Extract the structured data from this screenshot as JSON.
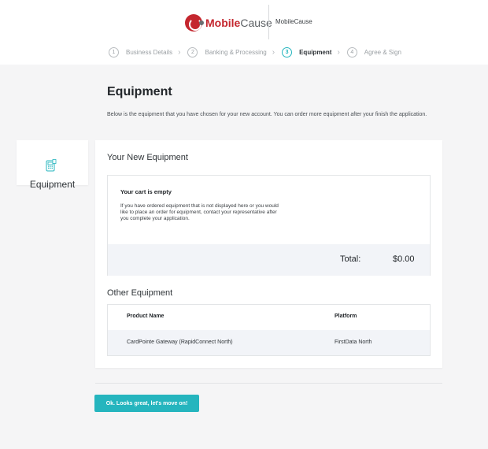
{
  "header": {
    "logo_strong": "Mobile",
    "logo_light": "Cause",
    "brand_name": "MobileCause"
  },
  "steps": [
    {
      "num": "1",
      "label": "Business Details",
      "active": false
    },
    {
      "num": "2",
      "label": "Banking & Processing",
      "active": false
    },
    {
      "num": "3",
      "label": "Equipment",
      "active": true
    },
    {
      "num": "4",
      "label": "Agree & Sign",
      "active": false
    }
  ],
  "page": {
    "title": "Equipment",
    "intro": "Below is the equipment that you have chosen for your new account. You can order more equipment after your finish the application."
  },
  "sidebar": {
    "label": "Equipment",
    "icon": "card-terminal-icon"
  },
  "new_equipment": {
    "title": "Your New Equipment",
    "cart_empty": "Your cart is empty",
    "cart_message": "If you have ordered equipment that is not displayed here or you would like to place an order for equipment, contact your representative after you complete your application.",
    "total_label": "Total:",
    "total_value": "$0.00"
  },
  "other_equipment": {
    "title": "Other Equipment",
    "columns": [
      "Product Name",
      "Platform"
    ],
    "rows": [
      {
        "product": "CardPointe Gateway (RapidConnect North)",
        "platform": "FirstData North"
      }
    ]
  },
  "actions": {
    "continue_label": "Ok. Looks great, let's move on!"
  },
  "colors": {
    "accent": "#25b5be",
    "brand_red": "#c4262e",
    "background": "#f5f5f6"
  }
}
